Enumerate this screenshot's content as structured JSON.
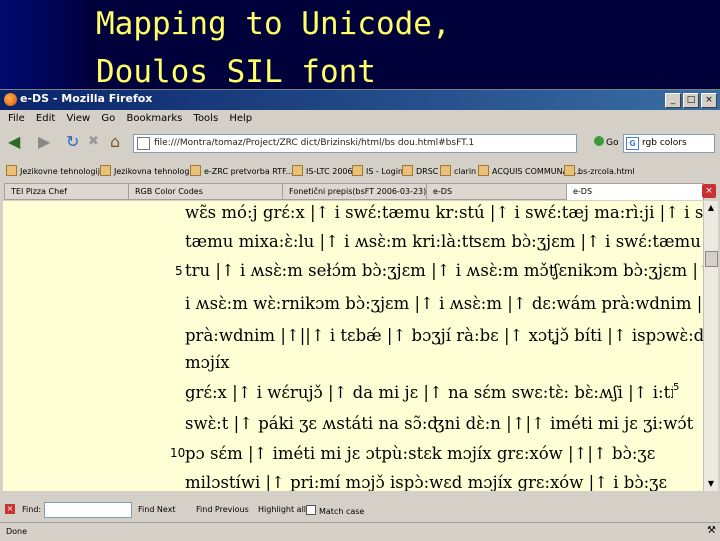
{
  "slide": {
    "title_line1": "Mapping to Unicode,",
    "title_line2": "Doulos SIL font"
  },
  "window": {
    "title": "e-DS - Mozilla Firefox",
    "controls": [
      "_",
      "□",
      "×"
    ]
  },
  "menu": [
    "File",
    "Edit",
    "View",
    "Go",
    "Bookmarks",
    "Tools",
    "Help"
  ],
  "nav": {
    "url": "file:///Montra/tomaz/Project/ZRC dict/Brizinski/html/bs dou.html#bsFT.1",
    "go_label": "Go",
    "search_value": "rgb colors",
    "search_engine_letter": "G"
  },
  "bookmarks": [
    "Jezikovne tehnologije",
    "Jezikovna tehnologije",
    "e-ZRC pretvorba RTF....",
    "IS-LTC 2006",
    "IS - Login",
    "DRSC",
    "clarin",
    "ACQUIS COMMUNAT....",
    "bs-zrcola.html"
  ],
  "tabs": [
    "TEI Pizza Chef",
    "RGB Color Codes",
    "Fonetični prepis(bsFT 2006-03-23)",
    "e-DS",
    "e-DS"
  ],
  "content": {
    "lines": [
      "wɛ̃s mó:j grɛ́:x |↑ i swɛ́:tæmu kr:stú |↑ i swɛ́:tæj ma:rì:ji |↑ i swɛ́:-",
      "tæmu mixa:ɛ̀:lu |↑ i ʍsɛ̀:m kri:là:tʦɛm bɔ̀:ʒjɛm |↑ i swɛ́:tæmu pé-",
      "tru |↑ i ʍsɛ̀:m sełɔ́m bɔ̀:ʒjɛm |↑ i ʍsɛ̀:m mɔ̌ʧɛnikɔm bɔ̀:ʒjɛm |↑",
      "i ʍsɛ̀:m wɛ̀:rnikɔm bɔ̀:ʒjɛm |↑ i ʍsɛ̀:m |↑ dɛ:wám prà:wdnim |↑ i ʍsɛ̀:m",
      "prà:wdnim |↑||↑ i tɛbǽ |↑ bɔʒjí rà:bɛ |↑ xɔtʝɔ̌ bíti |↑ ispɔwɛ̀:dɔn ʍsɛ̀:x",
      "mɔjíx",
      "grɛ́:x |↑ i wɛ́rujɔ̌ |↑ da mi jɛ |↑ na sɛ́m swɛ:tɛ̀: bɛ̀:ʍʃi |↑ i:tí ʒɛ na ɔ́n",
      "swɛ̀:t |↑ páki ʒɛ ʍstáti na sɔ̃:ʤni dɛ̀:n |↑|↑ iméti mi jɛ ʒi:wɔ́t",
      "pɔ sɛ́m |↑ iméti mi jɛ ɔtpù:stɛk mɔjíx grɛ:xów |↑|↑ bɔ̀:ʒɛ",
      "milɔstíwi |↑ pri:mí mɔjɔ̌ ispɔ̀:wɛd mɔjíx grɛ:xów |↑ i bɔ̀:ʒɛ"
    ],
    "line_numbers": [
      "5",
      "5",
      "10"
    ]
  },
  "find": {
    "label": "Find:",
    "next": "Find Next",
    "previous": "Find Previous",
    "highlight": "Highlight all",
    "match_case": "Match case"
  },
  "status": {
    "text": "Done"
  }
}
